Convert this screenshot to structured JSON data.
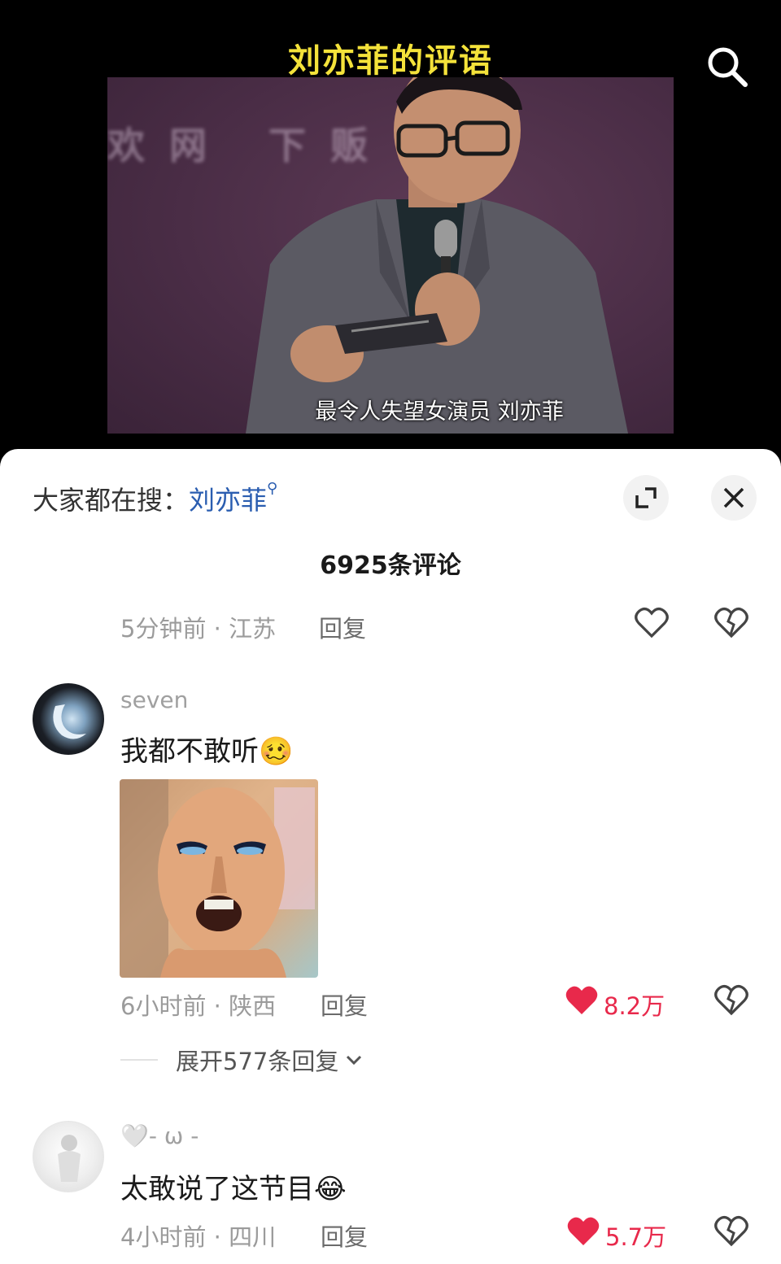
{
  "video": {
    "title": "刘亦菲的评语",
    "subtitle": "最令人失望女演员 刘亦菲",
    "background_text": "欢网 下贩"
  },
  "sheet": {
    "search_prefix": "大家都在搜：",
    "search_keyword": "刘亦菲",
    "comment_count": "6925条评论"
  },
  "comments": [
    {
      "meta": "5分钟前 · 江苏",
      "reply": "回复"
    },
    {
      "username": "seven",
      "text": "我都不敢听",
      "emoji": "🥴",
      "meta": "6小时前 · 陕西",
      "reply": "回复",
      "likes": "8.2万",
      "liked": true,
      "expand_replies": "展开577条回复"
    },
    {
      "username": "🤍- ω -",
      "text": "太敢说了这节目",
      "emoji": "😂",
      "meta": "4小时前 · 四川",
      "reply": "回复",
      "likes": "5.7万",
      "liked": true
    }
  ],
  "colors": {
    "title_yellow": "#f4e23a",
    "keyword_blue": "#2a5db0",
    "like_red": "#e8294b"
  }
}
